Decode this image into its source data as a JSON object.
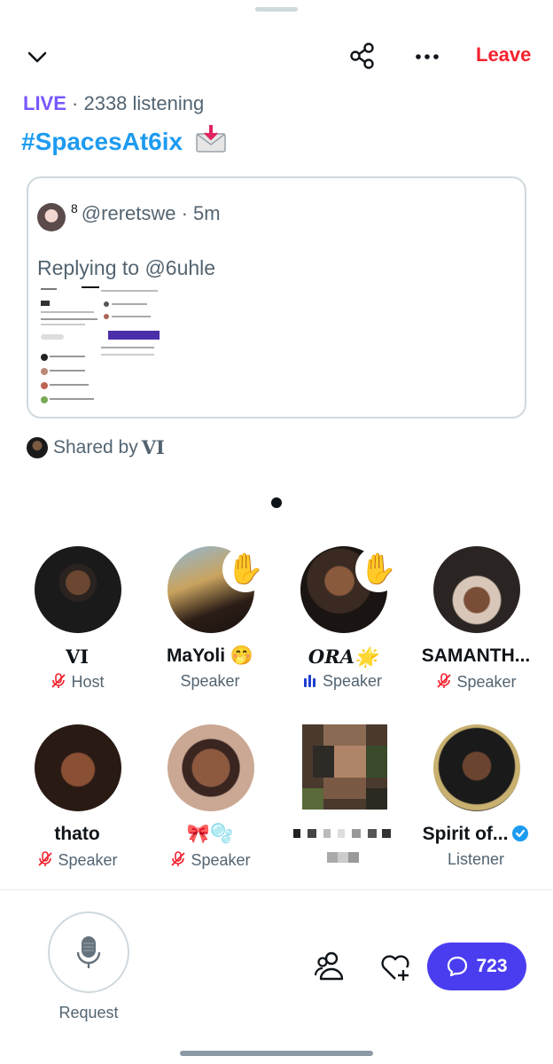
{
  "header": {
    "leave_label": "Leave",
    "icons": [
      "chevron-down-icon",
      "share-icon",
      "more-icon"
    ]
  },
  "space": {
    "live_label": "LIVE",
    "listening": "· 2338 listening",
    "title": "#SpacesAt6ix",
    "title_emoji": "📩"
  },
  "tweet": {
    "superscript": "8",
    "handle": "@reretswe · 5m",
    "replying_to": "Replying to @6uhle"
  },
  "shared_by": {
    "prefix": "Shared by",
    "name": "VI"
  },
  "participants": [
    {
      "name": "VI",
      "role": "Host",
      "muted": true,
      "hand_raised": false,
      "speaking": false
    },
    {
      "name": "MaYoli 🤭",
      "role": "Speaker",
      "muted": false,
      "hand_raised": true,
      "speaking": false
    },
    {
      "name": "ORA🌟",
      "role": "Speaker",
      "muted": false,
      "hand_raised": true,
      "speaking": true
    },
    {
      "name": "SAMANTH...",
      "role": "Speaker",
      "muted": true,
      "hand_raised": false,
      "speaking": false
    },
    {
      "name": "thato",
      "role": "Speaker",
      "muted": true,
      "hand_raised": false,
      "speaking": false
    },
    {
      "name": "🎀🫧",
      "role": "Speaker",
      "muted": true,
      "hand_raised": false,
      "speaking": false
    },
    {
      "name": "",
      "role": "",
      "muted": false,
      "hand_raised": false,
      "speaking": false
    },
    {
      "name": "Spirit of...",
      "role": "Listener",
      "muted": false,
      "hand_raised": false,
      "speaking": false,
      "verified": true
    }
  ],
  "hand_emoji": "✋",
  "bottom": {
    "request_label": "Request",
    "comment_count": "723"
  },
  "colors": {
    "live": "#7856ff",
    "title": "#1d9bf0",
    "leave": "#f4212e",
    "comment_button": "#4a3df0",
    "muted": "#f4212e"
  }
}
